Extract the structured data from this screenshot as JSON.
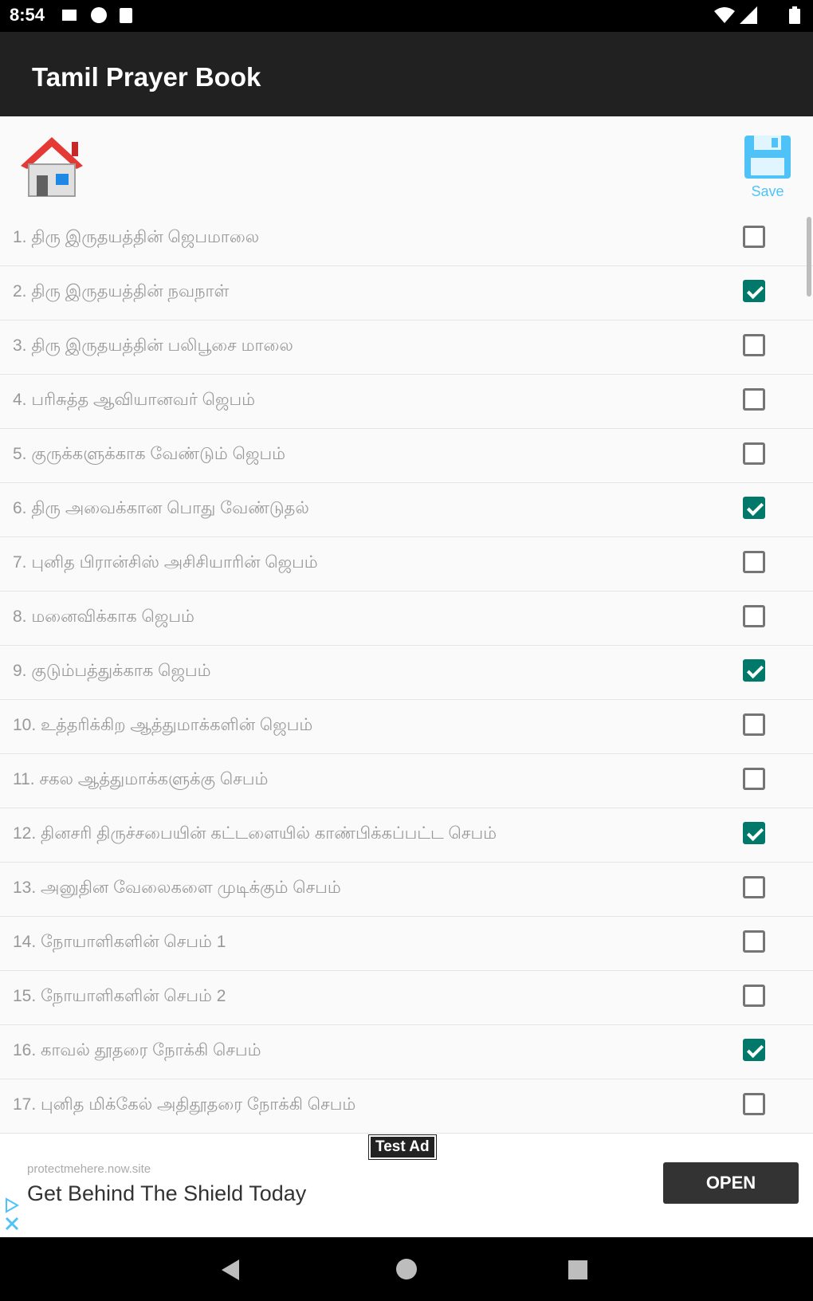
{
  "status_bar": {
    "time": "8:54"
  },
  "app_bar": {
    "title": "Tamil Prayer Book"
  },
  "toolbar": {
    "save_label": "Save"
  },
  "prayers": [
    {
      "label": "1.  திரு இருதயத்தின் ஜெபமாலை",
      "checked": false
    },
    {
      "label": "2.  திரு இருதயத்தின் நவநாள்",
      "checked": true
    },
    {
      "label": "3.  திரு இருதயத்தின் பலிபூசை மாலை",
      "checked": false
    },
    {
      "label": "4.  பரிசுத்த ஆவியானவர் ஜெபம்",
      "checked": false
    },
    {
      "label": "5.  குருக்களுக்காக வேண்டும் ஜெபம்",
      "checked": false
    },
    {
      "label": "6.  திரு அவைக்கான பொது வேண்டுதல்",
      "checked": true
    },
    {
      "label": "7.  புனித பிரான்சிஸ் அசிசியாரின் ஜெபம்",
      "checked": false
    },
    {
      "label": "8.  மனைவிக்காக ஜெபம்",
      "checked": false
    },
    {
      "label": "9.  குடும்பத்துக்காக ஜெபம்",
      "checked": true
    },
    {
      "label": "10.  உத்தரிக்கிற ஆத்துமாக்களின் ஜெபம்",
      "checked": false
    },
    {
      "label": "11.  சகல ஆத்துமாக்களுக்கு செபம்",
      "checked": false
    },
    {
      "label": "12.  தினசரி திருச்சபையின் கட்டளையில் காண்பிக்கப்பட்ட செபம்",
      "checked": true
    },
    {
      "label": "13.  அனுதின வேலைகளை முடிக்கும் செபம்",
      "checked": false
    },
    {
      "label": "14.  நோயாளிகளின் செபம் 1",
      "checked": false
    },
    {
      "label": "15.  நோயாளிகளின் செபம் 2",
      "checked": false
    },
    {
      "label": "16.  காவல் தூதரை நோக்கி செபம்",
      "checked": true
    },
    {
      "label": "17.  புனித மிக்கேல் அதிதூதரை நோக்கி செபம்",
      "checked": false
    }
  ],
  "ad": {
    "badge": "Test Ad",
    "domain": "protectmehere.now.site",
    "headline": "Get Behind The Shield Today",
    "button": "OPEN"
  },
  "colors": {
    "app_bar": "#212121",
    "checkbox_checked": "#00796b",
    "save_accent": "#4fc3f7",
    "home_roof": "#e53935"
  }
}
